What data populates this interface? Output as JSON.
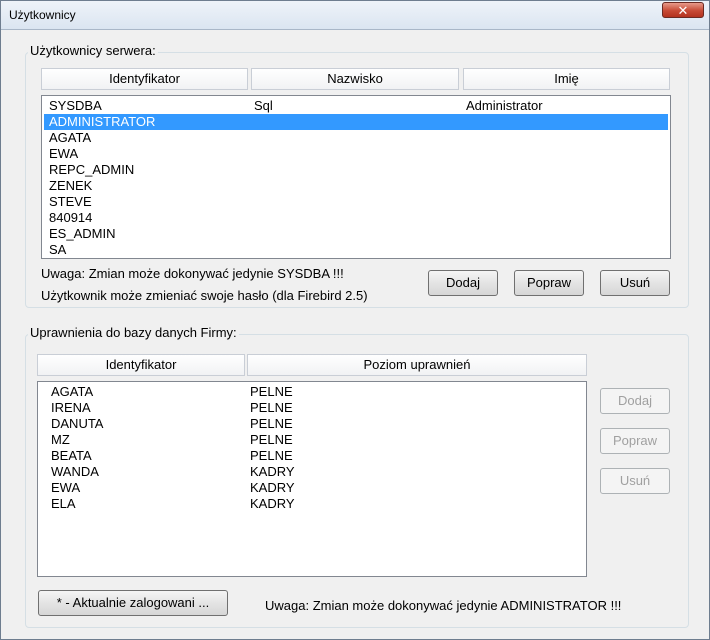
{
  "window": {
    "title": "Użytkownicy",
    "close_label": "✕"
  },
  "server_users": {
    "group_label": "Użytkownicy serwera:",
    "columns": [
      "Identyfikator",
      "Nazwisko",
      "Imię"
    ],
    "selected_index": 1,
    "rows": [
      [
        "SYSDBA",
        "Sql",
        "Administrator"
      ],
      [
        "ADMINISTRATOR",
        "",
        ""
      ],
      [
        "AGATA",
        "",
        ""
      ],
      [
        "EWA",
        "",
        ""
      ],
      [
        "REPC_ADMIN",
        "",
        ""
      ],
      [
        "ZENEK",
        "",
        ""
      ],
      [
        "STEVE",
        "",
        ""
      ],
      [
        "840914",
        "",
        ""
      ],
      [
        "ES_ADMIN",
        "",
        ""
      ],
      [
        "SA",
        "",
        ""
      ]
    ],
    "note_line1": "Uwaga:  Zmian może dokonywać jedynie SYSDBA !!!",
    "note_line2": "Użytkownik może zmieniać swoje hasło (dla Firebird 2.5)",
    "buttons": {
      "add": "Dodaj",
      "edit": "Popraw",
      "delete": "Usuń"
    }
  },
  "db_permissions": {
    "group_label": "Uprawnienia do bazy danych Firmy:",
    "columns": [
      "Identyfikator",
      "Poziom uprawnień"
    ],
    "rows": [
      [
        "AGATA",
        "PELNE"
      ],
      [
        "IRENA",
        "PELNE"
      ],
      [
        "DANUTA",
        "PELNE"
      ],
      [
        "MZ",
        "PELNE"
      ],
      [
        "BEATA",
        "PELNE"
      ],
      [
        "WANDA",
        "KADRY"
      ],
      [
        "EWA",
        "KADRY"
      ],
      [
        "ELA",
        "KADRY"
      ]
    ],
    "buttons": {
      "add": "Dodaj",
      "edit": "Popraw",
      "delete": "Usuń"
    },
    "logged_in_button": "* - Aktualnie zalogowani ...",
    "note": "Uwaga:  Zmian może dokonywać jedynie ADMINISTRATOR !!!"
  }
}
